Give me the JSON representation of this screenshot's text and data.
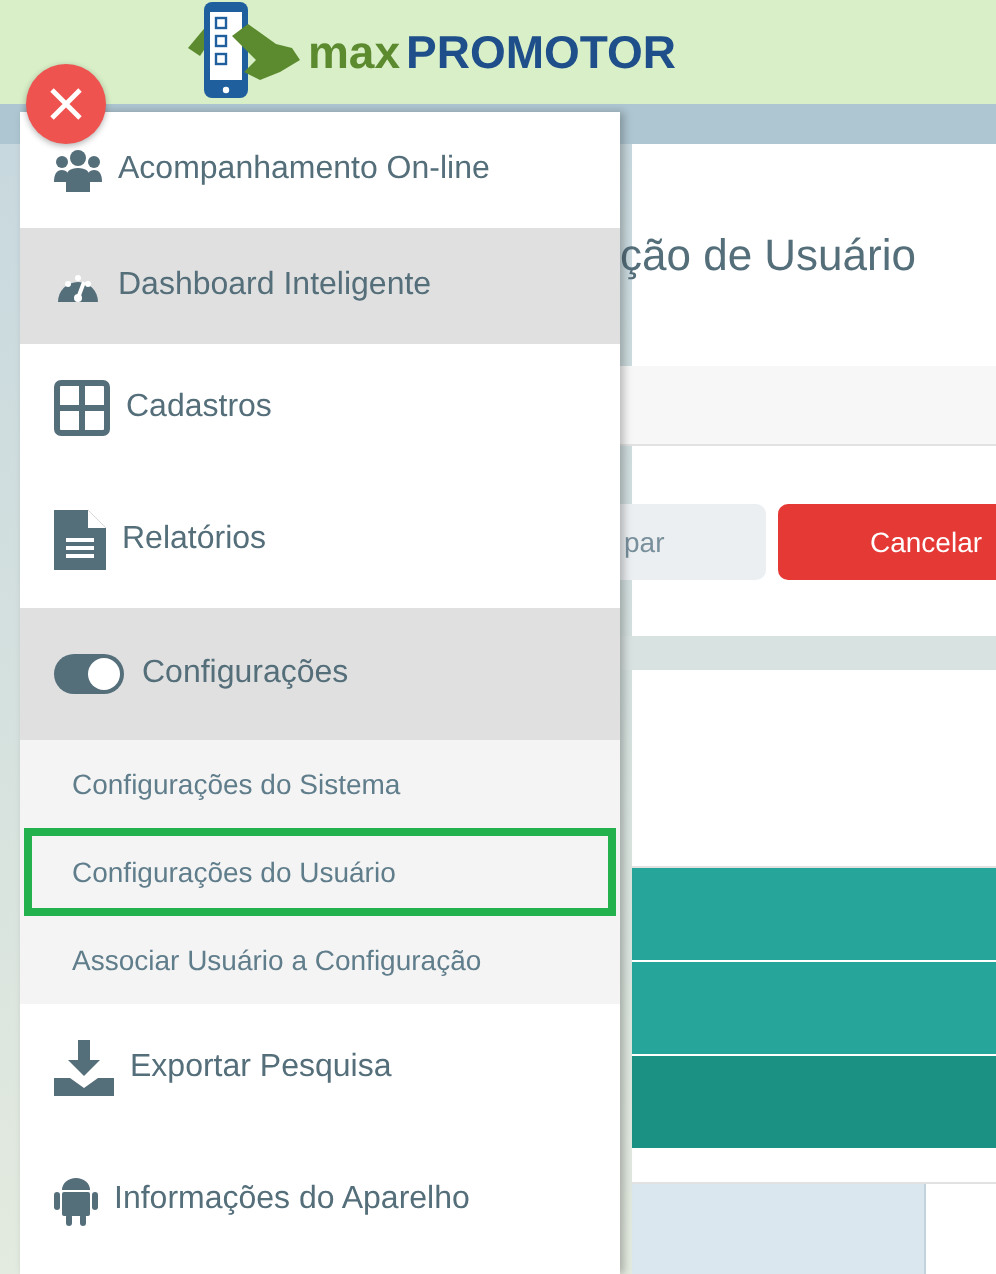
{
  "header": {
    "logo_prefix": "max",
    "logo_name": "PROMOTOR"
  },
  "page": {
    "title": "ção de Usuário",
    "buttons": [
      {
        "label": "par",
        "kind": "light"
      },
      {
        "label": "Cancelar",
        "kind": "danger"
      }
    ]
  },
  "menu": {
    "items": [
      {
        "label": "Acompanhamento On-line",
        "selected": false
      },
      {
        "label": "Dashboard Inteligente",
        "selected": true
      },
      {
        "label": "Cadastros",
        "selected": false
      },
      {
        "label": "Relatórios",
        "selected": false
      },
      {
        "label": "Configurações",
        "selected": true,
        "expanded": true,
        "children": [
          {
            "label": "Configurações do Sistema",
            "selected": false
          },
          {
            "label": "Configurações do Usuário",
            "selected": true
          },
          {
            "label": "Associar Usuário a Configuração",
            "selected": false
          }
        ]
      },
      {
        "label": "Exportar Pesquisa",
        "selected": false
      },
      {
        "label": "Informações do Aparelho",
        "selected": false
      }
    ]
  }
}
